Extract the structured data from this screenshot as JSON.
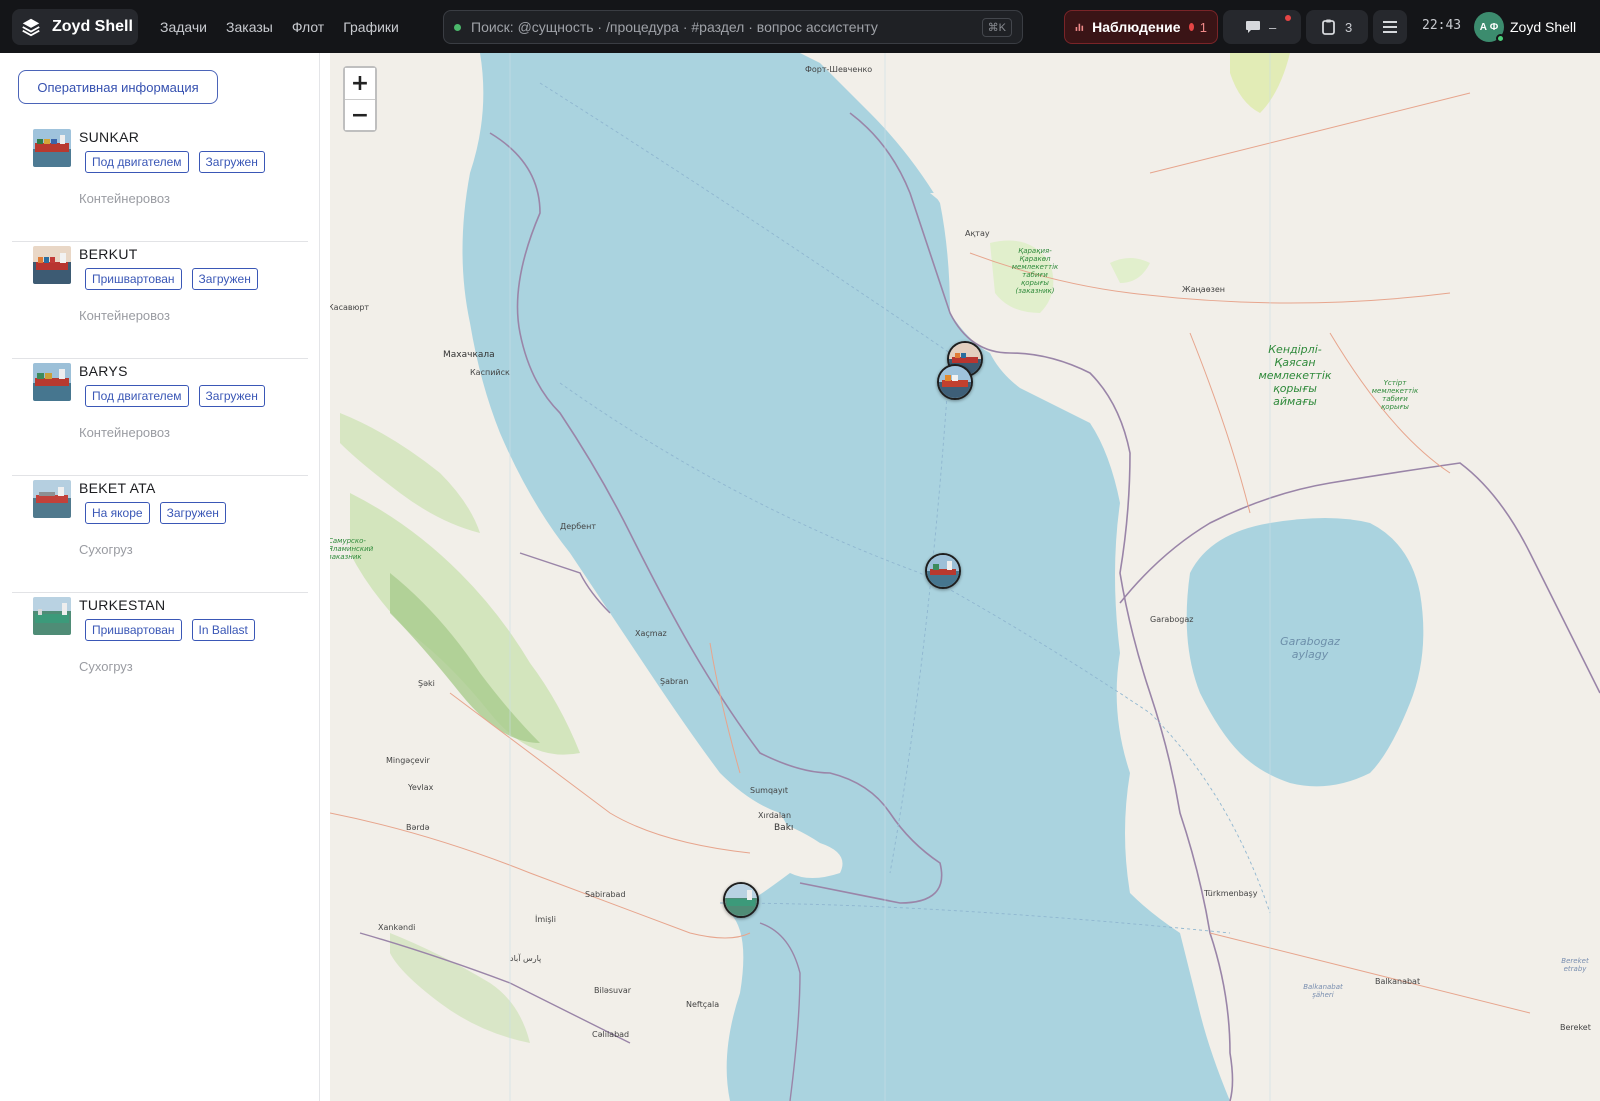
{
  "app": {
    "name": "Zoyd Shell"
  },
  "nav": [
    "Задачи",
    "Заказы",
    "Флот",
    "Графики"
  ],
  "search": {
    "placeholder": "Поиск: @сущность · /процедура · #раздел · вопрос ассистенту",
    "shortcut": "⌘K"
  },
  "watch": {
    "label": "Наблюдение",
    "count": "1"
  },
  "chat": {
    "value": "–"
  },
  "clipboard": {
    "count": "3"
  },
  "clock": "22:43",
  "user": {
    "initials": "А Ф",
    "name": "Zoyd Shell"
  },
  "sidebar": {
    "oper_button": "Оперативная информация",
    "vessels": [
      {
        "name": "SUNKAR",
        "status": "Под двигателем",
        "load": "Загружен",
        "type": "Контейнеровоз"
      },
      {
        "name": "BERKUT",
        "status": "Пришвартован",
        "load": "Загружен",
        "type": "Контейнеровоз"
      },
      {
        "name": "BARYS",
        "status": "Под двигателем",
        "load": "Загружен",
        "type": "Контейнеровоз"
      },
      {
        "name": "BEKET ATA",
        "status": "На якоре",
        "load": "Загружен",
        "type": "Сухогруз"
      },
      {
        "name": "TURKESTAN",
        "status": "Пришвартован",
        "load": "In Ballast",
        "type": "Сухогруз"
      }
    ]
  },
  "map": {
    "zoom_in": "+",
    "zoom_out": "−",
    "labels": {
      "fort": "Форт-Шевченко",
      "aktau": "Ақтау",
      "zhanaozen": "Жаңаөзен",
      "karakiya": "Қарақия-Қаракөл мемлекеттік табиғи қорығы (заказник)",
      "kendirli": "Кендірлі-Қаясан мемлекеттік қорығы аймағы",
      "ustirt": "Үстірт мемлекеттік табиғи қорығы",
      "makhachkala": "Махачкала",
      "kaspiysk": "Каспийск",
      "casabort": "Касавюрт",
      "derbent": "Дербент",
      "samur": "Самурско-Яламинский заказник",
      "xacmaz": "Xaçmaz",
      "sabran": "Şabran",
      "seki": "Şəki",
      "mingacevir": "Mingəçevir",
      "yevlax": "Yevlax",
      "barda": "Bərdə",
      "sumqayit": "Sumqayıt",
      "xirdalan": "Xırdalan",
      "baki": "Bakı",
      "sabirabad": "Sabirabad",
      "imisli": "İmişli",
      "xankandi": "Xankəndi",
      "parsabad": "پارس آباد",
      "bilasuvar": "Biləsuvar",
      "neftcala": "Neftçala",
      "calilabad": "Cəlilabad",
      "garabogaz": "Garabogaz",
      "garabogaz_aylagy": "Garabogaz aylagy",
      "turkmenbasy": "Türkmenbaşy",
      "balkanabat": "Balkanabat",
      "balkanabat_saheri": "Balkanabat şäheri",
      "bereket": "Bereket",
      "bereket_etraby": "Bereket etraby"
    }
  },
  "colors": {
    "sea": "#aad3df",
    "land": "#f2efe9",
    "accent": "#3a57b6",
    "danger": "#e64545"
  }
}
